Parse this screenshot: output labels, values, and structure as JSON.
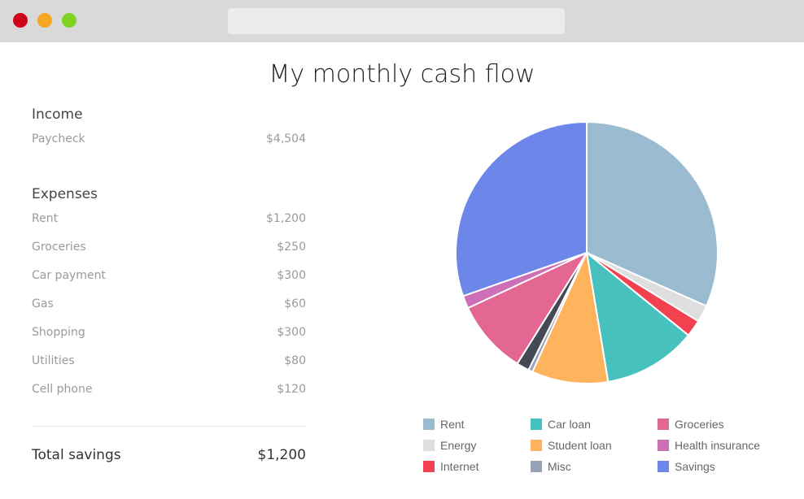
{
  "page": {
    "title": "My monthly cash flow"
  },
  "income": {
    "heading": "Income",
    "items": [
      {
        "label": "Paycheck",
        "amount": "$4,504"
      }
    ]
  },
  "expenses": {
    "heading": "Expenses",
    "items": [
      {
        "label": "Rent",
        "amount": "$1,200"
      },
      {
        "label": "Groceries",
        "amount": "$250"
      },
      {
        "label": "Car payment",
        "amount": "$300"
      },
      {
        "label": "Gas",
        "amount": "$60"
      },
      {
        "label": "Shopping",
        "amount": "$300"
      },
      {
        "label": "Utilities",
        "amount": "$80"
      },
      {
        "label": "Cell phone",
        "amount": "$120"
      }
    ]
  },
  "total": {
    "label": "Total savings",
    "amount": "$1,200"
  },
  "chart_data": {
    "type": "pie",
    "categories": [
      "Rent",
      "Energy",
      "Internet",
      "Car loan",
      "Student loan",
      "Misc",
      "Groceries",
      "Health insurance",
      "Savings"
    ],
    "values": [
      1210,
      80,
      80,
      440,
      360,
      20,
      60,
      350,
      60,
      1160
    ],
    "slices": [
      {
        "name": "Rent",
        "value": 1210,
        "color": "#9abbd0"
      },
      {
        "name": "Energy",
        "value": 80,
        "color": "#dedede"
      },
      {
        "name": "Internet",
        "value": 80,
        "color": "#f2424f"
      },
      {
        "name": "Car loan",
        "value": 440,
        "color": "#47c1be"
      },
      {
        "name": "Student loan",
        "value": 360,
        "color": "#ffb35c"
      },
      {
        "name": "Misc",
        "value": 20,
        "color": "#97a3b5"
      },
      {
        "name": "",
        "value": 60,
        "color": "#434a56"
      },
      {
        "name": "Groceries",
        "value": 350,
        "color": "#e36792"
      },
      {
        "name": "Health insurance",
        "value": 60,
        "color": "#cd6fb6"
      },
      {
        "name": "Savings",
        "value": 1160,
        "color": "#6c86ea"
      }
    ],
    "legend": [
      {
        "name": "Rent",
        "color": "#9abbd0"
      },
      {
        "name": "Energy",
        "color": "#dedede"
      },
      {
        "name": "Internet",
        "color": "#f2424f"
      },
      {
        "name": "Car loan",
        "color": "#47c1be"
      },
      {
        "name": "Student loan",
        "color": "#ffb35c"
      },
      {
        "name": "Misc",
        "color": "#97a3b5"
      },
      {
        "name": "Groceries",
        "color": "#e36792"
      },
      {
        "name": "Health insurance",
        "color": "#cd6fb6"
      },
      {
        "name": "Savings",
        "color": "#6c86ea"
      }
    ],
    "legend_placement": "bottom"
  }
}
